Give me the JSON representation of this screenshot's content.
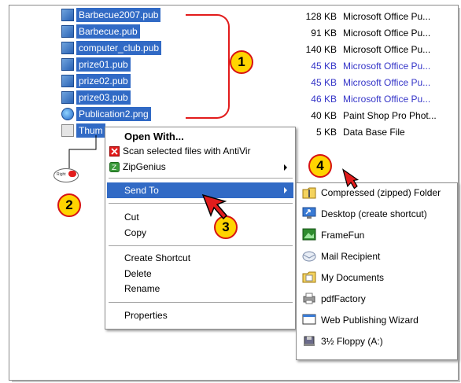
{
  "files": [
    {
      "name": "Barbecue2007.pub",
      "size": "128 KB",
      "type": "Microsoft Office Pu...",
      "icon": "publisher-icon",
      "blue": false
    },
    {
      "name": "Barbecue.pub",
      "size": "91 KB",
      "type": "Microsoft Office Pu...",
      "icon": "publisher-icon",
      "blue": false
    },
    {
      "name": "computer_club.pub",
      "size": "140 KB",
      "type": "Microsoft Office Pu...",
      "icon": "publisher-icon",
      "blue": false
    },
    {
      "name": "prize01.pub",
      "size": "45 KB",
      "type": "Microsoft Office Pu...",
      "icon": "publisher-icon",
      "blue": true
    },
    {
      "name": "prize02.pub",
      "size": "45 KB",
      "type": "Microsoft Office Pu...",
      "icon": "publisher-icon",
      "blue": true
    },
    {
      "name": "prize03.pub",
      "size": "46 KB",
      "type": "Microsoft Office Pu...",
      "icon": "publisher-icon",
      "blue": true
    },
    {
      "name": "Publication2.png",
      "size": "40 KB",
      "type": "Paint Shop Pro Phot...",
      "icon": "image-icon",
      "blue": false
    },
    {
      "name": "Thum",
      "size": "5 KB",
      "type": "Data Base File",
      "icon": "database-icon",
      "blue": false
    }
  ],
  "context_menu": {
    "open_with": "Open With...",
    "scan": "Scan selected files with AntiVir",
    "zipgenius": "ZipGenius",
    "send_to": "Send To",
    "cut": "Cut",
    "copy": "Copy",
    "create_shortcut": "Create Shortcut",
    "delete": "Delete",
    "rename": "Rename",
    "properties": "Properties"
  },
  "send_to_menu": [
    {
      "label": "Compressed (zipped) Folder",
      "icon": "zip-folder-icon"
    },
    {
      "label": "Desktop (create shortcut)",
      "icon": "desktop-icon"
    },
    {
      "label": "FrameFun",
      "icon": "framefun-icon"
    },
    {
      "label": "Mail Recipient",
      "icon": "mail-icon"
    },
    {
      "label": "My Documents",
      "icon": "my-documents-icon"
    },
    {
      "label": "pdfFactory",
      "icon": "printer-icon"
    },
    {
      "label": "Web Publishing Wizard",
      "icon": "web-wizard-icon"
    },
    {
      "label": "3½ Floppy (A:)",
      "icon": "floppy-icon"
    }
  ],
  "mouse_label": "Right",
  "badges": [
    "1",
    "2",
    "3",
    "4"
  ],
  "colors": {
    "selection": "#316ac5",
    "annotation": "#e21c1c",
    "badge": "#ffd400",
    "blue_text": "#3535c8"
  }
}
